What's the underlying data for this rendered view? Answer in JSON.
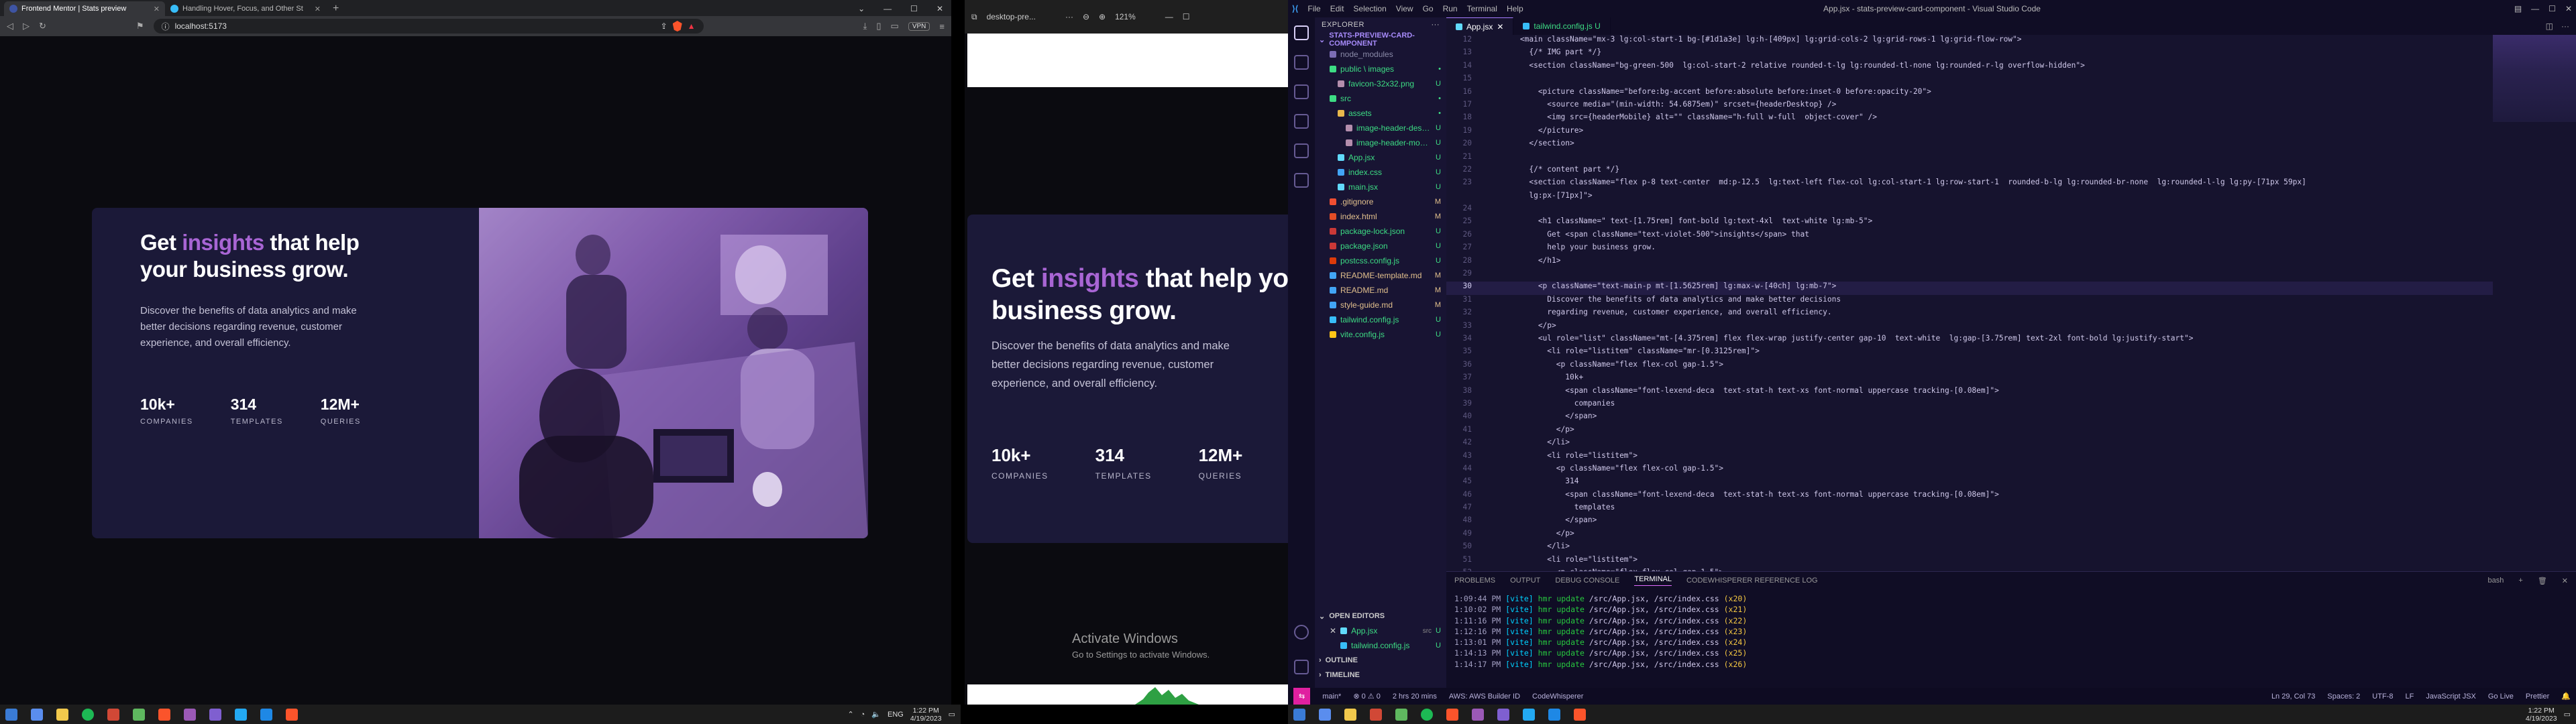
{
  "browser": {
    "tabs": [
      {
        "title": "Frontend Mentor | Stats preview",
        "active": true,
        "fav_color": "#3e54a3"
      },
      {
        "title": "Handling Hover, Focus, and Other St",
        "active": false,
        "fav_color": "#38bdf8"
      }
    ],
    "url": "localhost:5173",
    "vpn_label": "VPN"
  },
  "card": {
    "heading_pre": "Get ",
    "heading_highlight": "insights",
    "heading_post": " that help your business grow.",
    "description": "Discover the benefits of data analytics and make better decisions regarding revenue, customer experience, and overall efficiency.",
    "stats": [
      {
        "value": "10k+",
        "label": "COMPANIES"
      },
      {
        "value": "314",
        "label": "TEMPLATES"
      },
      {
        "value": "12M+",
        "label": "QUERIES"
      }
    ]
  },
  "win2": {
    "title": "desktop-pre...",
    "zoom": "121%",
    "activate_title": "Activate Windows",
    "activate_sub": "Go to Settings to activate Windows."
  },
  "vscode": {
    "menu": [
      "File",
      "Edit",
      "Selection",
      "View",
      "Go",
      "Run",
      "Terminal",
      "Help"
    ],
    "window_title": "App.jsx - stats-preview-card-component - Visual Studio Code",
    "explorer_title": "EXPLORER",
    "project_name": "STATS-PREVIEW-CARD-COMPONENT",
    "tree": [
      {
        "name": "node_modules",
        "indent": 1,
        "color": "#8a8aa8",
        "badge": "",
        "badge_color": "#8a8aa8",
        "icon": "#7c6db5"
      },
      {
        "name": "public \\ images",
        "indent": 1,
        "color": "#3ddc84",
        "badge": "•",
        "badge_color": "#3ddc84",
        "icon": "#3ddc84"
      },
      {
        "name": "favicon-32x32.png",
        "indent": 2,
        "color": "#3ddc84",
        "badge": "U",
        "badge_color": "#3ddc84",
        "icon": "#b48ead"
      },
      {
        "name": "src",
        "indent": 1,
        "color": "#3ddc84",
        "badge": "•",
        "badge_color": "#3ddc84",
        "icon": "#3ddc84"
      },
      {
        "name": "assets",
        "indent": 2,
        "color": "#3ddc84",
        "badge": "•",
        "badge_color": "#3ddc84",
        "icon": "#e8b84c"
      },
      {
        "name": "image-header-desktop.jpg",
        "indent": 3,
        "color": "#3ddc84",
        "badge": "U",
        "badge_color": "#3ddc84",
        "icon": "#b48ead"
      },
      {
        "name": "image-header-mobile.jpg",
        "indent": 3,
        "color": "#3ddc84",
        "badge": "U",
        "badge_color": "#3ddc84",
        "icon": "#b48ead"
      },
      {
        "name": "App.jsx",
        "indent": 2,
        "color": "#3ddc84",
        "badge": "U",
        "badge_color": "#3ddc84",
        "icon": "#61dafb"
      },
      {
        "name": "index.css",
        "indent": 2,
        "color": "#3ddc84",
        "badge": "U",
        "badge_color": "#3ddc84",
        "icon": "#42a5f5"
      },
      {
        "name": "main.jsx",
        "indent": 2,
        "color": "#3ddc84",
        "badge": "U",
        "badge_color": "#3ddc84",
        "icon": "#61dafb"
      },
      {
        "name": ".gitignore",
        "indent": 1,
        "color": "#e2c08d",
        "badge": "M",
        "badge_color": "#e2c08d",
        "icon": "#f14e32"
      },
      {
        "name": "index.html",
        "indent": 1,
        "color": "#e2c08d",
        "badge": "M",
        "badge_color": "#e2c08d",
        "icon": "#e44d26"
      },
      {
        "name": "package-lock.json",
        "indent": 1,
        "color": "#3ddc84",
        "badge": "U",
        "badge_color": "#3ddc84",
        "icon": "#cb3837"
      },
      {
        "name": "package.json",
        "indent": 1,
        "color": "#3ddc84",
        "badge": "U",
        "badge_color": "#3ddc84",
        "icon": "#cb3837"
      },
      {
        "name": "postcss.config.js",
        "indent": 1,
        "color": "#3ddc84",
        "badge": "U",
        "badge_color": "#3ddc84",
        "icon": "#dd3a0a"
      },
      {
        "name": "README-template.md",
        "indent": 1,
        "color": "#e2c08d",
        "badge": "M",
        "badge_color": "#e2c08d",
        "icon": "#42a5f5"
      },
      {
        "name": "README.md",
        "indent": 1,
        "color": "#e2c08d",
        "badge": "M",
        "badge_color": "#e2c08d",
        "icon": "#42a5f5"
      },
      {
        "name": "style-guide.md",
        "indent": 1,
        "color": "#e2c08d",
        "badge": "M",
        "badge_color": "#e2c08d",
        "icon": "#42a5f5"
      },
      {
        "name": "tailwind.config.js",
        "indent": 1,
        "color": "#3ddc84",
        "badge": "U",
        "badge_color": "#3ddc84",
        "icon": "#38bdf8"
      },
      {
        "name": "vite.config.js",
        "indent": 1,
        "color": "#3ddc84",
        "badge": "U",
        "badge_color": "#3ddc84",
        "icon": "#ffc517"
      }
    ],
    "open_editors_title": "OPEN EDITORS",
    "open_editors": [
      {
        "name": "App.jsx",
        "dir": "src",
        "badge": "U"
      },
      {
        "name": "tailwind.config.js",
        "dir": "",
        "badge": "U"
      }
    ],
    "outline_title": "OUTLINE",
    "timeline_title": "TIMELINE",
    "tabs": [
      {
        "name": "App.jsx",
        "active": true
      },
      {
        "name": "tailwind.config.js U",
        "active": false
      }
    ],
    "code_lines": [
      {
        "n": "12",
        "t": "        <main className=\"mx-3 lg:col-start-1 bg-[#1d1a3e] lg:h-[409px] lg:grid-cols-2 lg:grid-rows-1 lg:grid-flow-row\">"
      },
      {
        "n": "13",
        "t": "          {/* IMG part */}"
      },
      {
        "n": "14",
        "t": "          <section className=\"bg-green-500  lg:col-start-2 relative rounded-t-lg lg:rounded-tl-none lg:rounded-r-lg overflow-hidden\">"
      },
      {
        "n": "15",
        "t": ""
      },
      {
        "n": "16",
        "t": "            <picture className=\"before:bg-accent before:absolute before:inset-0 before:opacity-20\">"
      },
      {
        "n": "17",
        "t": "              <source media=\"(min-width: 54.6875em)\" srcset={headerDesktop} />"
      },
      {
        "n": "18",
        "t": "              <img src={headerMobile} alt=\"\" className=\"h-full w-full  object-cover\" />"
      },
      {
        "n": "19",
        "t": "            </picture>"
      },
      {
        "n": "20",
        "t": "          </section>"
      },
      {
        "n": "21",
        "t": ""
      },
      {
        "n": "22",
        "t": "          {/* content part */}"
      },
      {
        "n": "23",
        "t": "          <section className=\"flex p-8 text-center  md:p-12.5  lg:text-left flex-col lg:col-start-1 lg:row-start-1  rounded-b-lg lg:rounded-br-none  lg:rounded-l-lg lg:py-[71px 59px]"
      },
      {
        "n": "",
        "t": "          lg:px-[71px]\">"
      },
      {
        "n": "24",
        "t": ""
      },
      {
        "n": "25",
        "t": "            <h1 className=\" text-[1.75rem] font-bold lg:text-4xl  text-white lg:mb-5\">"
      },
      {
        "n": "26",
        "t": "              Get <span className=\"text-violet-500\">insights</span> that"
      },
      {
        "n": "27",
        "t": "              help your business grow."
      },
      {
        "n": "28",
        "t": "            </h1>"
      },
      {
        "n": "29",
        "t": ""
      },
      {
        "n": "30",
        "t": "            <p className=\"text-main-p mt-[1.5625rem] lg:max-w-[40ch] lg:mb-7\">"
      },
      {
        "n": "31",
        "t": "              Discover the benefits of data analytics and make better decisions"
      },
      {
        "n": "32",
        "t": "              regarding revenue, customer experience, and overall efficiency."
      },
      {
        "n": "33",
        "t": "            </p>"
      },
      {
        "n": "34",
        "t": "            <ul role=\"list\" className=\"mt-[4.375rem] flex flex-wrap justify-center gap-10  text-white  lg:gap-[3.75rem] text-2xl font-bold lg:justify-start\">"
      },
      {
        "n": "35",
        "t": "              <li role=\"listitem\" className=\"mr-[0.3125rem]\">"
      },
      {
        "n": "36",
        "t": "                <p className=\"flex flex-col gap-1.5\">"
      },
      {
        "n": "37",
        "t": "                  10k+"
      },
      {
        "n": "38",
        "t": "                  <span className=\"font-lexend-deca  text-stat-h text-xs font-normal uppercase tracking-[0.08em]\">"
      },
      {
        "n": "39",
        "t": "                    companies"
      },
      {
        "n": "40",
        "t": "                  </span>"
      },
      {
        "n": "41",
        "t": "                </p>"
      },
      {
        "n": "42",
        "t": "              </li>"
      },
      {
        "n": "43",
        "t": "              <li role=\"listitem\">"
      },
      {
        "n": "44",
        "t": "                <p className=\"flex flex-col gap-1.5\">"
      },
      {
        "n": "45",
        "t": "                  314"
      },
      {
        "n": "46",
        "t": "                  <span className=\"font-lexend-deca  text-stat-h text-xs font-normal uppercase tracking-[0.08em]\">"
      },
      {
        "n": "47",
        "t": "                    templates"
      },
      {
        "n": "48",
        "t": "                  </span>"
      },
      {
        "n": "49",
        "t": "                </p>"
      },
      {
        "n": "50",
        "t": "              </li>"
      },
      {
        "n": "51",
        "t": "              <li role=\"listitem\">"
      },
      {
        "n": "52",
        "t": "                <p className=\"flex flex-col gap-1.5\">"
      }
    ],
    "current_line": "30",
    "panel_tabs": [
      "PROBLEMS",
      "OUTPUT",
      "DEBUG CONSOLE",
      "TERMINAL",
      "CODEWHISPERER REFERENCE LOG"
    ],
    "panel_active": "TERMINAL",
    "terminal_shell": "bash",
    "terminal_lines": [
      {
        "time": "1:09:44 PM",
        "path": "/src/App.jsx, /src/index.css",
        "count": "(x20)"
      },
      {
        "time": "1:10:02 PM",
        "path": "/src/App.jsx, /src/index.css",
        "count": "(x21)"
      },
      {
        "time": "1:11:16 PM",
        "path": "/src/App.jsx, /src/index.css",
        "count": "(x22)"
      },
      {
        "time": "1:12:16 PM",
        "path": "/src/App.jsx, /src/index.css",
        "count": "(x23)"
      },
      {
        "time": "1:13:01 PM",
        "path": "/src/App.jsx, /src/index.css",
        "count": "(x24)"
      },
      {
        "time": "1:14:13 PM",
        "path": "/src/App.jsx, /src/index.css",
        "count": "(x25)"
      },
      {
        "time": "1:14:17 PM",
        "path": "/src/App.jsx, /src/index.css",
        "count": "(x26)"
      }
    ],
    "status_left": [
      "main*",
      "⊗ 0 ⚠ 0",
      "2 hrs 20 mins",
      "AWS: AWS Builder ID",
      "CodeWhisperer"
    ],
    "status_right": [
      "Ln 29, Col 73",
      "Spaces: 2",
      "UTF-8",
      "LF",
      "JavaScript JSX",
      "Go Live",
      "Prettier"
    ]
  },
  "taskbar": {
    "left_time": "1:22 PM",
    "left_date": "4/19/2023",
    "right_time": "1:22 PM",
    "right_date": "4/19/2023",
    "lang": "ENG"
  }
}
